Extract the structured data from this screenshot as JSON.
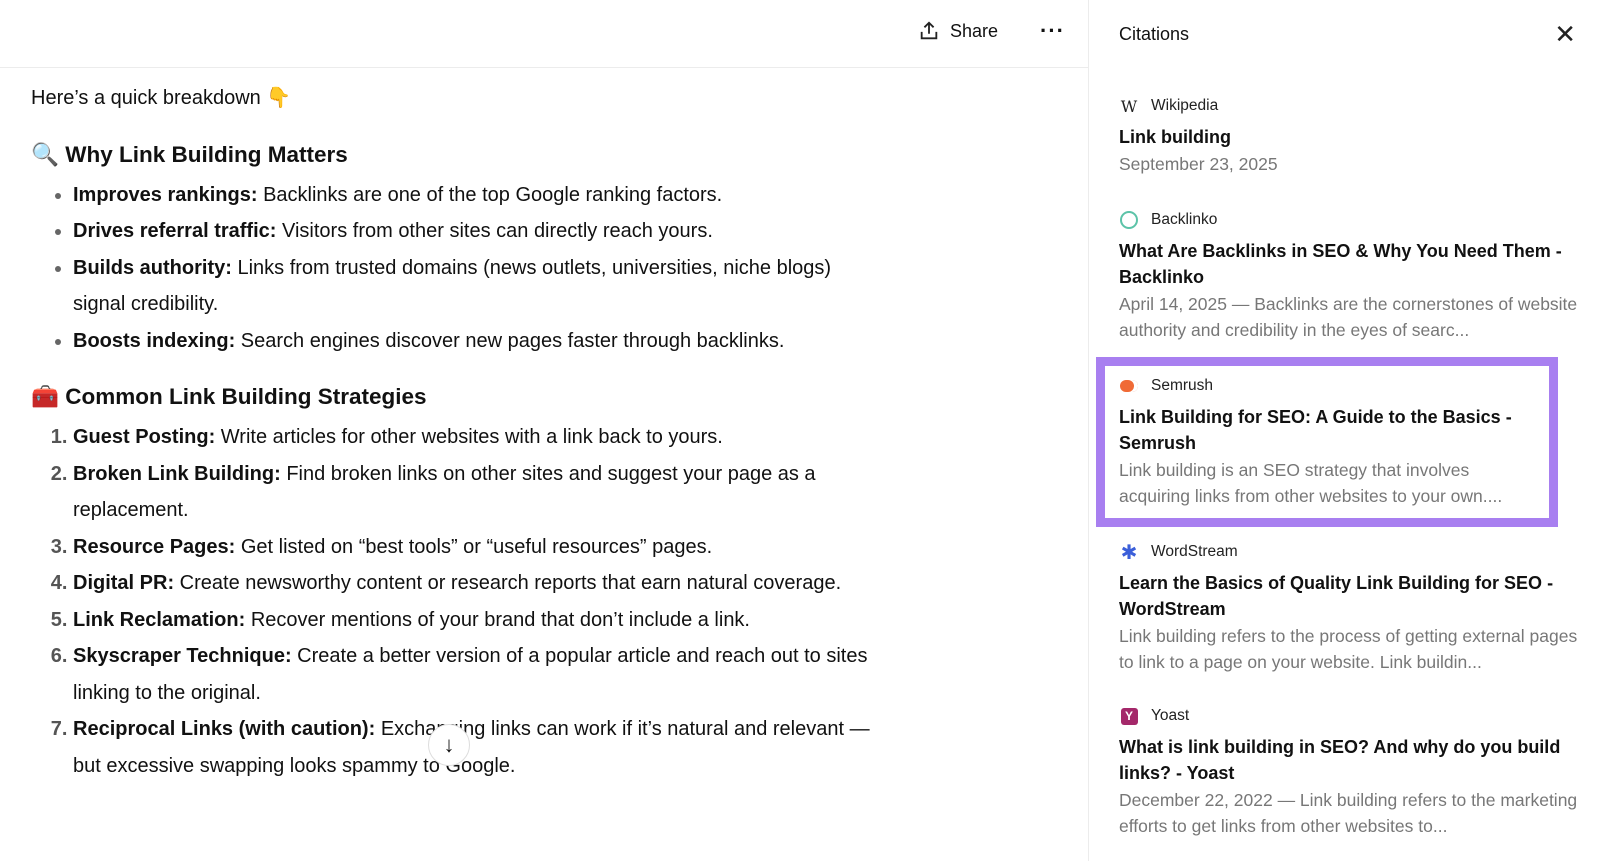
{
  "toolbar": {
    "share_label": "Share",
    "more_label": "···"
  },
  "content": {
    "intro": "Here’s a quick breakdown 👇",
    "section1": {
      "emoji": "🔍",
      "title": "Why Link Building Matters",
      "items": [
        {
          "bold": "Improves rankings:",
          "text": " Backlinks are one of the top Google ranking factors."
        },
        {
          "bold": "Drives referral traffic:",
          "text": " Visitors from other sites can directly reach yours."
        },
        {
          "bold": "Builds authority:",
          "text": " Links from trusted domains (news outlets, universities, niche blogs) signal credibility."
        },
        {
          "bold": "Boosts indexing:",
          "text": " Search engines discover new pages faster through backlinks."
        }
      ]
    },
    "section2": {
      "emoji": "🧰",
      "title": "Common Link Building Strategies",
      "items": [
        {
          "bold": "Guest Posting:",
          "text": " Write articles for other websites with a link back to yours."
        },
        {
          "bold": "Broken Link Building:",
          "text": " Find broken links on other sites and suggest your page as a replacement."
        },
        {
          "bold": "Resource Pages:",
          "text": " Get listed on “best tools” or “useful resources” pages."
        },
        {
          "bold": "Digital PR:",
          "text": " Create newsworthy content or research reports that earn natural coverage."
        },
        {
          "bold": "Link Reclamation:",
          "text": " Recover mentions of your brand that don’t include a link."
        },
        {
          "bold": "Skyscraper Technique:",
          "text": " Create a better version of a popular article and reach out to sites linking to the original."
        },
        {
          "bold": "Reciprocal Links (with caution):",
          "text": " Exchanging links can work if it’s natural and relevant — but excessive swapping looks spammy to Google."
        }
      ]
    }
  },
  "citations": {
    "title": "Citations",
    "highlight_color": "#a87ff0",
    "items": [
      {
        "source": "Wikipedia",
        "icon": "W",
        "title": "Link building",
        "snippet": "September 23, 2025"
      },
      {
        "source": "Backlinko",
        "icon": "○",
        "title": "What Are Backlinks in SEO & Why You Need Them - Backlinko",
        "snippet": "April 14, 2025 — Backlinks are the cornerstones of website authority and credibility in the eyes of searc..."
      },
      {
        "source": "Semrush",
        "icon": "semrush-logo",
        "title": "Link Building for SEO: A Guide to the Basics - Semrush",
        "snippet": "Link building is an SEO strategy that involves acquiring links from other websites to your own...."
      },
      {
        "source": "WordStream",
        "icon": "✱",
        "title": "Learn the Basics of Quality Link Building for SEO - WordStream",
        "snippet": "Link building refers to the process of getting external pages to link to a page on your website. Link buildin..."
      },
      {
        "source": "Yoast",
        "icon": "Y",
        "title": "What is link building in SEO? And why do you build links? - Yoast",
        "snippet": "December 22, 2022 — Link building refers to the marketing efforts to get links from other websites to..."
      }
    ]
  }
}
